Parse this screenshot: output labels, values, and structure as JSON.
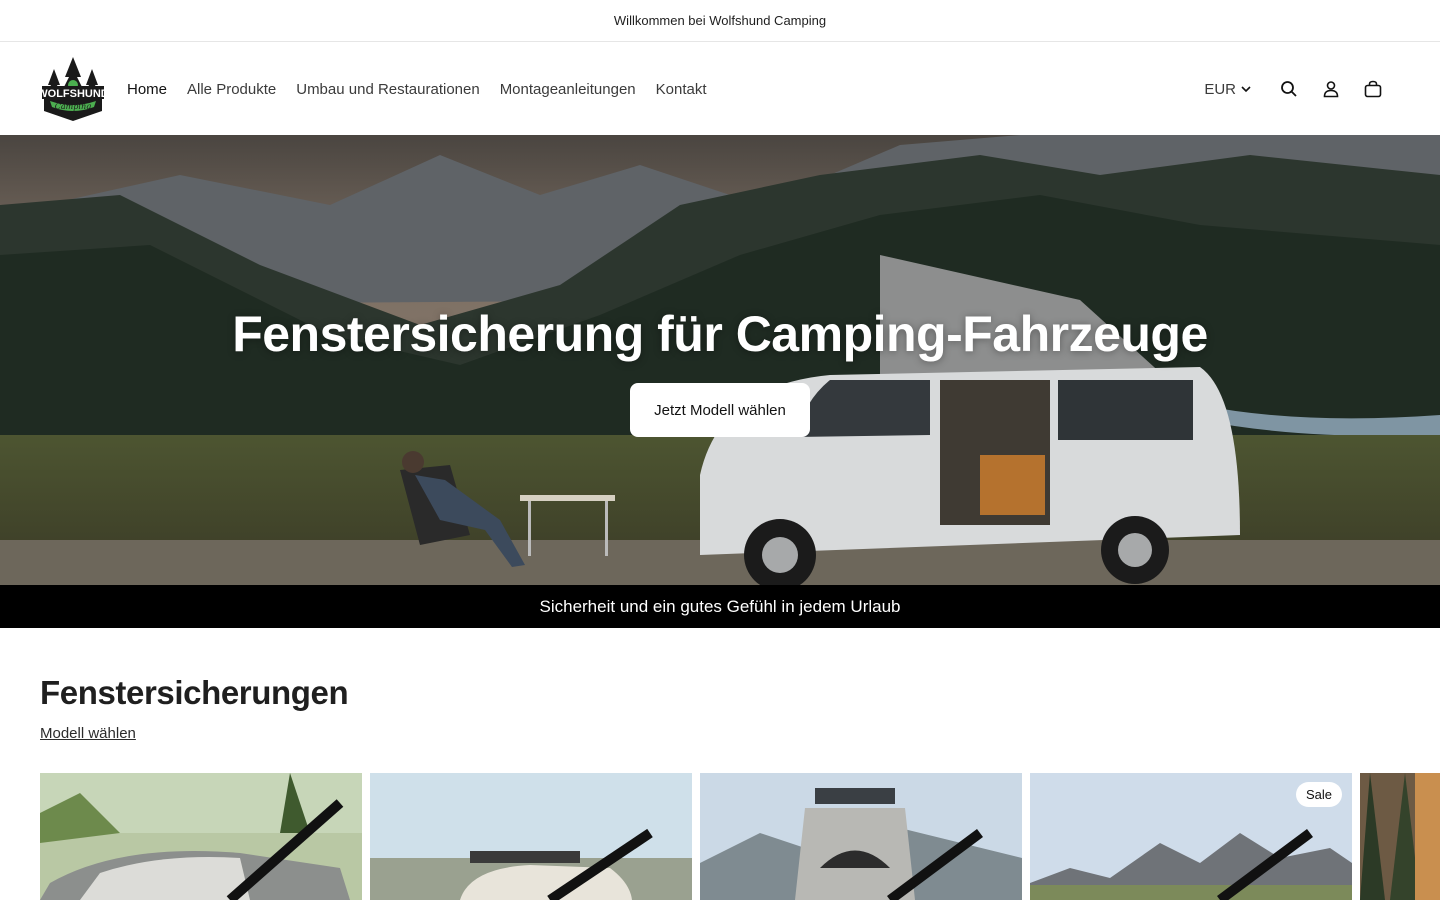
{
  "announcement": {
    "text": "Willkommen bei Wolfshund Camping"
  },
  "header": {
    "logo": {
      "alt": "Wolfshund Camping",
      "line1": "WOLFSHUND",
      "line2": "Camping"
    },
    "nav": [
      {
        "label": "Home"
      },
      {
        "label": "Alle Produkte"
      },
      {
        "label": "Umbau und Restaurationen"
      },
      {
        "label": "Montageanleitungen"
      },
      {
        "label": "Kontakt"
      }
    ],
    "currency": "EUR",
    "icons": [
      "search-icon",
      "account-icon",
      "cart-icon"
    ]
  },
  "hero": {
    "title": "Fenstersicherung für Camping-Fahrzeuge",
    "button": "Jetzt Modell wählen"
  },
  "tagline": {
    "text": "Sicherheit und ein gutes Gefühl in jedem Urlaub"
  },
  "collection": {
    "title": "Fenstersicherungen",
    "link": "Modell wählen",
    "cards": [
      {
        "badge": ""
      },
      {
        "badge": ""
      },
      {
        "badge": ""
      },
      {
        "badge": "Sale"
      },
      {
        "badge": ""
      }
    ]
  },
  "colors": {
    "accent": "#121212",
    "tagline_bg": "#000000",
    "logo_green": "#4caf50"
  }
}
